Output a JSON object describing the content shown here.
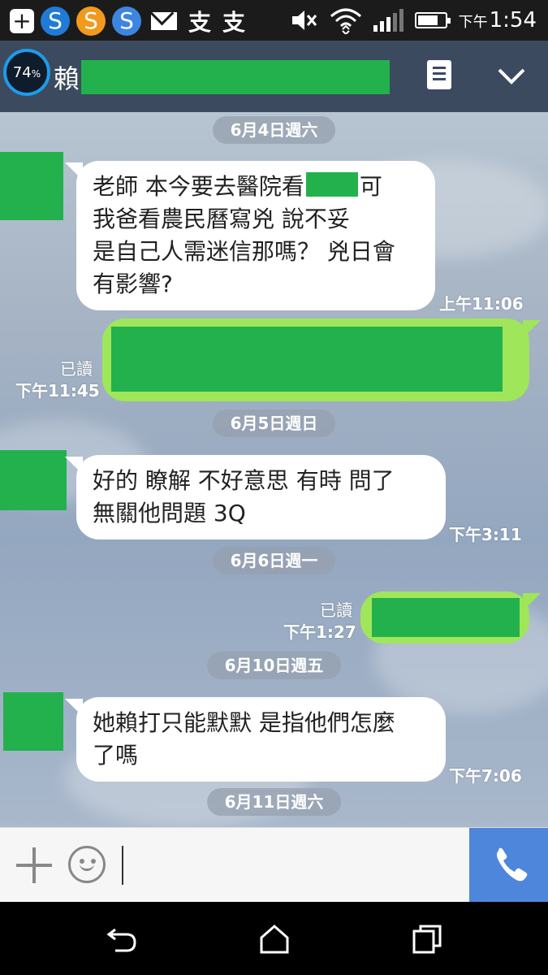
{
  "status_bar": {
    "plus_icon": "+",
    "s_icons": [
      "S",
      "S",
      "S"
    ],
    "zh_icons": [
      "支",
      "支"
    ],
    "time_ampm": "下午",
    "time": "1:54",
    "battery_level": 0.74
  },
  "header": {
    "battery_ring_value": "74",
    "battery_ring_unit": "%",
    "chat_name_first": "賴"
  },
  "messages": {
    "date1": "6月4日週六",
    "msg1_line1_pre": "老師 本今要去醫院看",
    "msg1_line1_post": "可",
    "msg1_line2": "我爸看農民曆寫兇 說不妥",
    "msg1_line3": "是自己人需迷信那嗎？ 兇日會",
    "msg1_line4": "有影響?",
    "msg1_time": "上午11:06",
    "msg2_read": "已讀",
    "msg2_time": "下午11:45",
    "date2": "6月5日週日",
    "msg3_line1": "好的 瞭解 不好意思 有時 問了",
    "msg3_line2": "無關他問題 3Q",
    "msg3_time": "下午3:11",
    "date3": "6月6日週一",
    "msg4_read": "已讀",
    "msg4_time": "下午1:27",
    "date4": "6月10日週五",
    "msg5_line1": "她賴打只能默默 是指他們怎麼",
    "msg5_line2": "了嗎",
    "msg5_time": "下午7:06",
    "date5": "6月11日週六"
  },
  "colors": {
    "redaction": "#22b14c",
    "outgoing_bubble": "#a0e65a",
    "call_button": "#4e86dc",
    "header_bg": "#3c4a5f"
  }
}
